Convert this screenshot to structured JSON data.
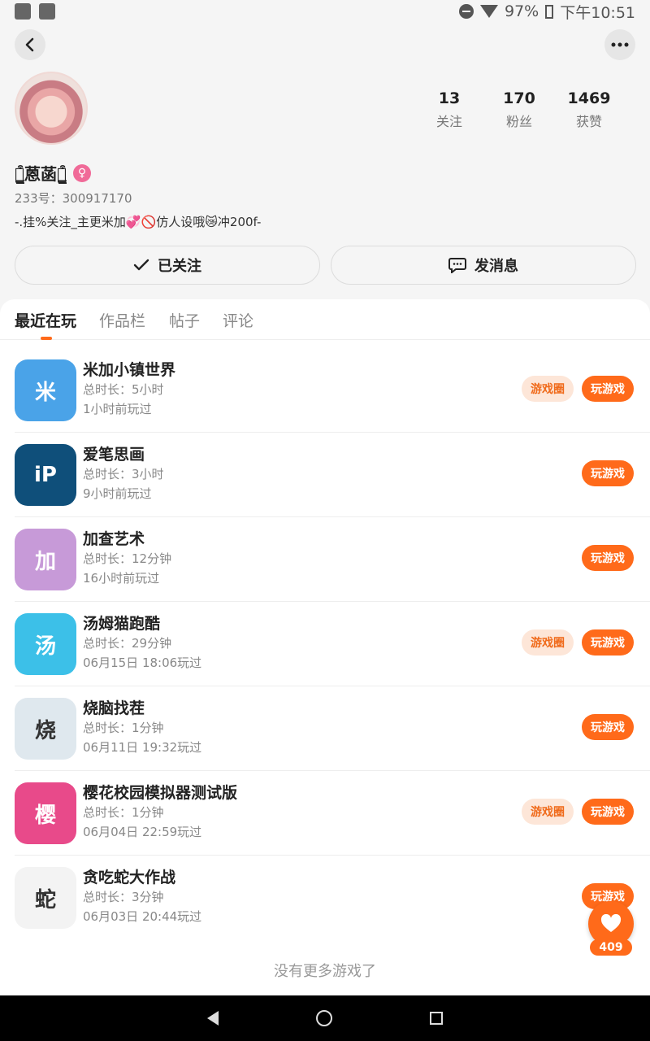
{
  "status_bar": {
    "battery": "97%",
    "time": "下午10:51"
  },
  "profile": {
    "stats": [
      {
        "num": "13",
        "label": "关注"
      },
      {
        "num": "170",
        "label": "粉丝"
      },
      {
        "num": "1469",
        "label": "获赞"
      }
    ],
    "username": "ฅ̳͒蒽菡ฅ̳͒",
    "gender_symbol": "♀",
    "uid": "233号：300917170",
    "bio": "-.挂%关注_主更米加💞🚫仿人设哦😿冲200f-",
    "follow_label": "已关注",
    "message_label": "发消息"
  },
  "tabs": [
    "最近在玩",
    "作品栏",
    "帖子",
    "评论"
  ],
  "games": [
    {
      "name": "米加小镇世界",
      "duration": "总时长：5小时",
      "last_played": "1小时前玩过",
      "has_circle": true,
      "icon_color": "#4aa3e8",
      "icon_glyph": "米"
    },
    {
      "name": "爱笔思画",
      "duration": "总时长：3小时",
      "last_played": "9小时前玩过",
      "has_circle": false,
      "icon_color": "#0f4f7a",
      "icon_glyph": "iP"
    },
    {
      "name": "加查艺术",
      "duration": "总时长：12分钟",
      "last_played": "16小时前玩过",
      "has_circle": false,
      "icon_color": "#c79ad8",
      "icon_glyph": "加"
    },
    {
      "name": "汤姆猫跑酷",
      "duration": "总时长：29分钟",
      "last_played": "06月15日 18:06玩过",
      "has_circle": true,
      "icon_color": "#3cc0e8",
      "icon_glyph": "汤"
    },
    {
      "name": "烧脑找茬",
      "duration": "总时长：1分钟",
      "last_played": "06月11日 19:32玩过",
      "has_circle": false,
      "icon_color": "#dfe8ee",
      "icon_glyph": "烧"
    },
    {
      "name": "樱花校园模拟器测试版",
      "duration": "总时长：1分钟",
      "last_played": "06月04日 22:59玩过",
      "has_circle": true,
      "icon_color": "#e84a8a",
      "icon_glyph": "樱"
    },
    {
      "name": "贪吃蛇大作战",
      "duration": "总时长：3分钟",
      "last_played": "06月03日 20:44玩过",
      "has_circle": false,
      "icon_color": "#f3f3f3",
      "icon_glyph": "蛇"
    }
  ],
  "buttons": {
    "circle_label": "游戏圈",
    "play_label": "玩游戏"
  },
  "footer_note": "没有更多游戏了",
  "like_count": "409",
  "colors": {
    "accent": "#ff6a1a",
    "accent_light": "#fde6d8"
  }
}
